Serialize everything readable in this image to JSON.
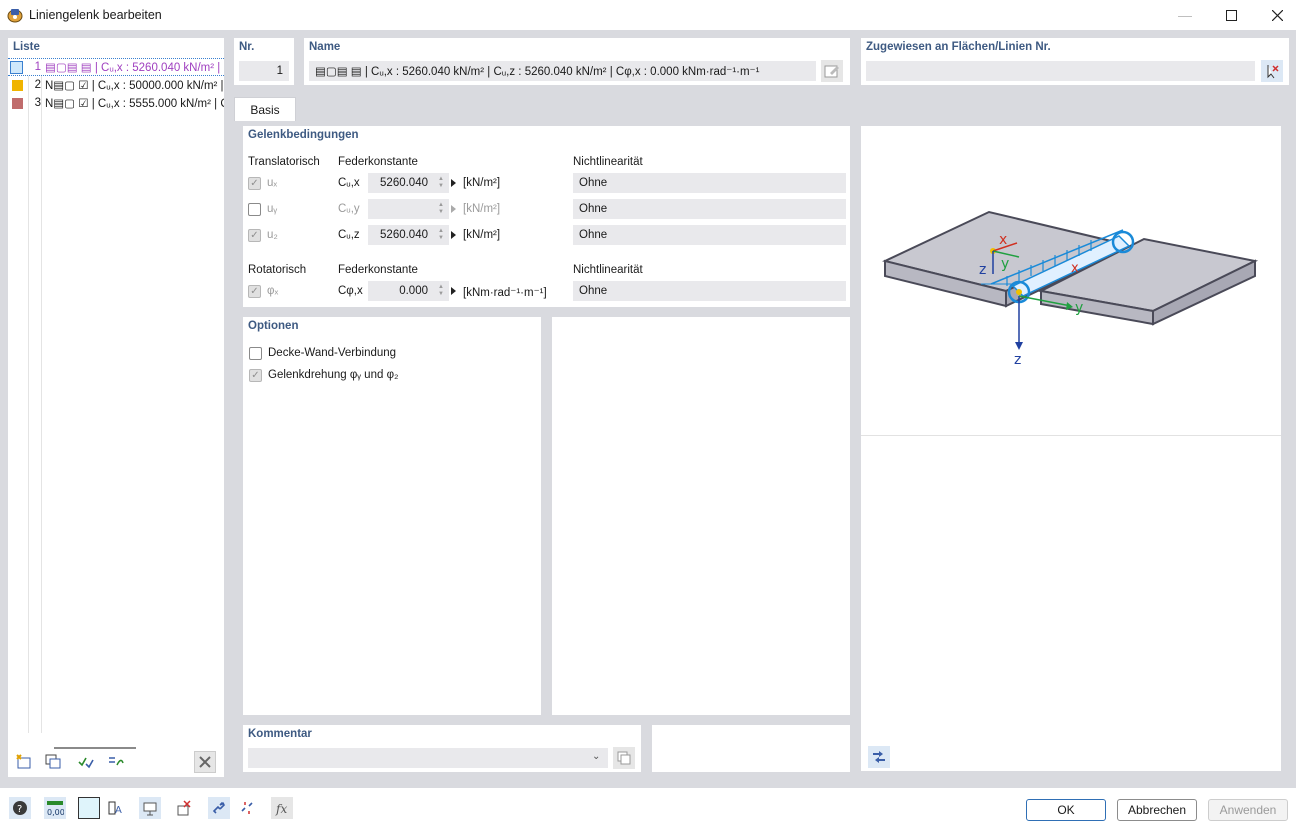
{
  "window": {
    "title": "Liniengelenk bearbeiten"
  },
  "list": {
    "header": "Liste",
    "items": [
      {
        "num": "1",
        "color": "#8cc8ec",
        "text": "▤▢▤ ▤ | Cᵤ,x : 5260.040 kN/m² | C",
        "selected": true
      },
      {
        "num": "2",
        "color": "#f0b400",
        "text": "N▤▢ ☑ | Cᵤ,x : 50000.000 kN/m² |"
      },
      {
        "num": "3",
        "color": "#c06c6c",
        "text": "N▤▢ ☑ | Cᵤ,x : 5555.000 kN/m² | C"
      }
    ]
  },
  "number": {
    "label": "Nr.",
    "value": "1"
  },
  "name": {
    "label": "Name",
    "value": "▤▢▤ ▤ | Cᵤ,x : 5260.040 kN/m² | Cᵤ,z : 5260.040 kN/m² | Cφ,x : 0.000 kNm·rad⁻¹·m⁻¹"
  },
  "assigned": {
    "label": "Zugewiesen an Flächen/Linien Nr.",
    "value": ""
  },
  "tabs": [
    {
      "label": "Basis"
    }
  ],
  "conditions": {
    "header": "Gelenkbedingungen",
    "translational_label": "Translatorisch",
    "spring_label": "Federkonstante",
    "nonlinear_label": "Nichtlinearität",
    "rotational_label": "Rotatorisch",
    "rows": [
      {
        "dof": "uₓ",
        "const": "Cᵤ,x",
        "value": "5260.040",
        "unit": "[kN/m²]",
        "nonlinear": "Ohne",
        "enabled": true
      },
      {
        "dof": "uᵧ",
        "const": "Cᵤ,y",
        "value": "",
        "unit": "[kN/m²]",
        "nonlinear": "Ohne",
        "enabled": false
      },
      {
        "dof": "u₂",
        "const": "Cᵤ,z",
        "value": "5260.040",
        "unit": "[kN/m²]",
        "nonlinear": "Ohne",
        "enabled": true
      }
    ],
    "rot_row": {
      "dof": "φₓ",
      "const": "Cφ,x",
      "value": "0.000",
      "unit": "[kNm·rad⁻¹·m⁻¹]",
      "nonlinear": "Ohne"
    }
  },
  "options": {
    "header": "Optionen",
    "items": [
      {
        "label": "Decke-Wand-Verbindung",
        "checked": false
      },
      {
        "label": "Gelenkdrehung φᵧ und φ₂",
        "checked": true
      }
    ]
  },
  "comment": {
    "label": "Kommentar",
    "value": ""
  },
  "diagram": {
    "axis_x": "x",
    "axis_y": "y",
    "axis_z": "z",
    "axis_z2": "z",
    "axis_y2": "y"
  },
  "buttons": {
    "ok": "OK",
    "cancel": "Abbrechen",
    "apply": "Anwenden"
  },
  "colors": {
    "accent": "#3e5a82",
    "panel_bg": "#d9dadf",
    "field_bg": "#e9e9ec"
  }
}
